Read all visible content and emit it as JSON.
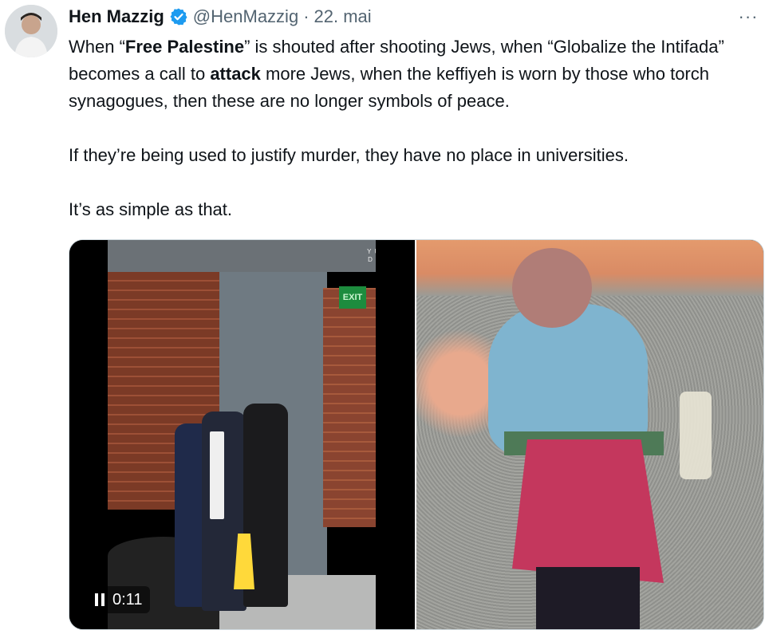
{
  "author": {
    "name": "Hen Mazzig",
    "handle": "@HenMazzig",
    "separator": "·",
    "date": "22. mai",
    "verified": true
  },
  "more_icon": "···",
  "tweet": {
    "line1_a": "When “",
    "line1_bold": "Free Palestine",
    "line1_b": "” is shouted after shooting Jews, when “Globalize the Intifada” becomes a call to ",
    "line1_bold2": "attack",
    "line1_c": " more Jews, when the keffiyeh is worn by those who torch synagogues, then these are no longer symbols of peace.",
    "para2": "If they’re being used to justify murder, they have no place in universities.",
    "para3": "It’s as simple as that."
  },
  "media": {
    "video_watermark": "YUVAL DAVID",
    "exit_sign": "EXIT",
    "video_time": "0:11"
  },
  "colors": {
    "verified": "#1d9bf0",
    "secondary_text": "#536471",
    "border": "#cfd9de"
  }
}
